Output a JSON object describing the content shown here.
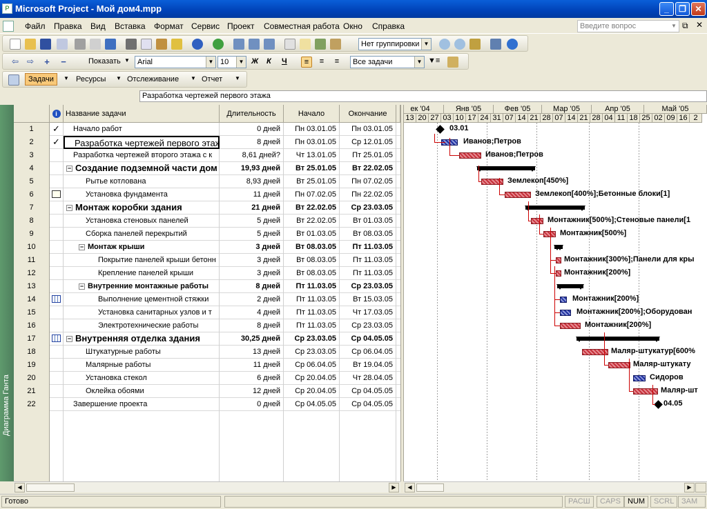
{
  "window": {
    "title": "Microsoft Project - Мой дом4.mpp"
  },
  "menu": [
    "Файл",
    "Правка",
    "Вид",
    "Вставка",
    "Формат",
    "Сервис",
    "Проект",
    "Совместная работа",
    "Окно",
    "Справка"
  ],
  "help_placeholder": "Введите вопрос",
  "toolbar1": {
    "grouping": "Нет группировки"
  },
  "toolbar2": {
    "show": "Показать",
    "font": "Arial",
    "size": "10",
    "filter": "Все задачи"
  },
  "toolbar3": {
    "tasks": "Задачи",
    "resources": "Ресурсы",
    "tracking": "Отслеживание",
    "report": "Отчет"
  },
  "entry_bar": "Разработка чертежей первого этажа",
  "view_bar": "Диаграмма Ганта",
  "columns": {
    "name": "Название задачи",
    "duration": "Длительность",
    "start": "Начало",
    "finish": "Окончание"
  },
  "tasks": [
    {
      "id": "1",
      "name": "Начало работ",
      "dur": "0 дней",
      "start": "Пн 03.01.05",
      "finish": "Пн 03.01.05",
      "pred": ""
    },
    {
      "id": "2",
      "name": "Разработка чертежей первого этажа",
      "dur": "8 дней",
      "start": "Пн 03.01.05",
      "finish": "Ср 12.01.05",
      "pred": ""
    },
    {
      "id": "3",
      "name": "Разработка чертежей второго этажа с к",
      "dur": "8,61 дней?",
      "start": "Чт 13.01.05",
      "finish": "Пт 25.01.05",
      "pred": ""
    },
    {
      "id": "4",
      "name": "Создание подземной части дом",
      "dur": "19,93 дней",
      "start": "Вт 25.01.05",
      "finish": "Вт 22.02.05",
      "pred": ""
    },
    {
      "id": "5",
      "name": "Рытье котлована",
      "dur": "8,93 дней",
      "start": "Вт 25.01.05",
      "finish": "Пн 07.02.05",
      "pred": ""
    },
    {
      "id": "6",
      "name": "Установка фундамента",
      "dur": "11 дней",
      "start": "Пн 07.02.05",
      "finish": "Пн 22.02.05",
      "pred": ""
    },
    {
      "id": "7",
      "name": "Монтаж коробки здания",
      "dur": "21 дней",
      "start": "Вт 22.02.05",
      "finish": "Ср 23.03.05",
      "pred": ""
    },
    {
      "id": "8",
      "name": "Установка стеновых панелей",
      "dur": "5 дней",
      "start": "Вт 22.02.05",
      "finish": "Вт 01.03.05",
      "pred": ""
    },
    {
      "id": "9",
      "name": "Сборка панелей перекрытий",
      "dur": "5 дней",
      "start": "Вт 01.03.05",
      "finish": "Вт 08.03.05",
      "pred": ""
    },
    {
      "id": "10",
      "name": "Монтаж крыши",
      "dur": "3 дней",
      "start": "Вт 08.03.05",
      "finish": "Пт 11.03.05",
      "pred": ""
    },
    {
      "id": "11",
      "name": "Покрытие панелей крыши бетонн",
      "dur": "3 дней",
      "start": "Вт 08.03.05",
      "finish": "Пт 11.03.05",
      "pred": ""
    },
    {
      "id": "12",
      "name": "Крепление панелей крыши",
      "dur": "3 дней",
      "start": "Вт 08.03.05",
      "finish": "Пт 11.03.05",
      "pred": ""
    },
    {
      "id": "13",
      "name": "Внутренние монтажные работы",
      "dur": "8 дней",
      "start": "Пт 11.03.05",
      "finish": "Ср 23.03.05",
      "pred": ""
    },
    {
      "id": "14",
      "name": "Выполнение цементной стяжки",
      "dur": "2 дней",
      "start": "Пт 11.03.05",
      "finish": "Вт 15.03.05",
      "pred": ""
    },
    {
      "id": "15",
      "name": "Установка санитарных узлов и т",
      "dur": "4 дней",
      "start": "Пт 11.03.05",
      "finish": "Чт 17.03.05",
      "pred": ""
    },
    {
      "id": "16",
      "name": "Электротехнические работы",
      "dur": "8 дней",
      "start": "Пт 11.03.05",
      "finish": "Ср 23.03.05",
      "pred": ""
    },
    {
      "id": "17",
      "name": "Внутренняя отделка здания",
      "dur": "30,25 дней",
      "start": "Ср 23.03.05",
      "finish": "Ср 04.05.05",
      "pred": ""
    },
    {
      "id": "18",
      "name": "Штукатурные работы",
      "dur": "13 дней",
      "start": "Ср 23.03.05",
      "finish": "Ср 06.04.05",
      "pred": ""
    },
    {
      "id": "19",
      "name": "Малярные работы",
      "dur": "11 дней",
      "start": "Ср 06.04.05",
      "finish": "Вт 19.04.05",
      "pred": ""
    },
    {
      "id": "20",
      "name": "Установка стекол",
      "dur": "6 дней",
      "start": "Ср 20.04.05",
      "finish": "Чт 28.04.05",
      "pred": ""
    },
    {
      "id": "21",
      "name": "Оклейка обоями",
      "dur": "12 дней",
      "start": "Ср 20.04.05",
      "finish": "Ср 04.05.05",
      "pred": ""
    },
    {
      "id": "22",
      "name": "Завершение проекта",
      "dur": "0 дней",
      "start": "Ср 04.05.05",
      "finish": "Ср 04.05.05",
      "pred": ""
    }
  ],
  "timescale": {
    "months": [
      "ек '04",
      "Янв '05",
      "Фев '05",
      "Мар '05",
      "Апр '05",
      "Май '05"
    ],
    "days": [
      "13",
      "20",
      "27",
      "03",
      "10",
      "17",
      "24",
      "31",
      "07",
      "14",
      "21",
      "28",
      "07",
      "14",
      "21",
      "28",
      "04",
      "11",
      "18",
      "25",
      "02",
      "09",
      "16",
      "2"
    ]
  },
  "gantt_labels": [
    "03.01",
    "Иванов;Петров",
    "Иванов;Петров",
    "Землекоп[450%]",
    "Землекоп[400%];Бетонные блоки[1]",
    "Монтажник[500%];Стеновые панели[1",
    "Монтажник[500%]",
    "Монтажник[300%];Панели для кры",
    "Монтажник[200%]",
    "Монтажник[200%]",
    "Монтажник[200%];Оборудован",
    "Монтажник[200%]",
    "Маляр-штукатур[600%",
    "Маляр-штукату",
    "Сидоров",
    "Маляр-шт",
    "04.05"
  ],
  "status": {
    "ready": "Готово",
    "caps1": "РАСШ",
    "caps2": "CAPS",
    "num": "NUM",
    "scrl": "SCRL",
    "zam": "ЗАМ"
  }
}
